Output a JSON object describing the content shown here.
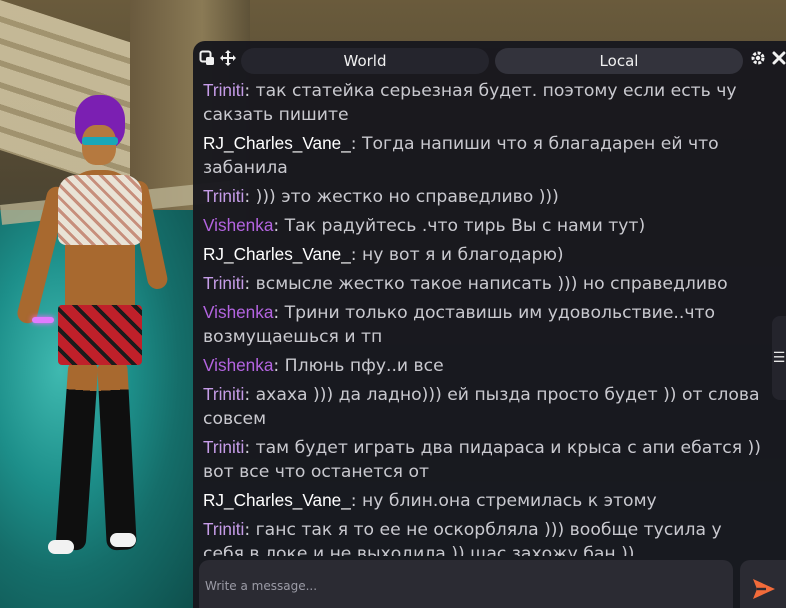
{
  "chat": {
    "tabs": [
      {
        "label": "World",
        "active": false
      },
      {
        "label": "Local",
        "active": true
      }
    ],
    "icons": {
      "popout": "popout-icon",
      "move": "move-icon",
      "settings": "gear-icon",
      "close": "close-icon",
      "menu": "menu-icon",
      "send": "send-icon"
    },
    "colors": {
      "triniti": "#c69ce8",
      "vishenka": "#b364e0",
      "rj": "#ffffff",
      "text": "#c9c9cf",
      "send": "#f26b3a"
    },
    "messages": [
      {
        "user": "Triniti",
        "text": "так статейка серьезная будет. поэтому если есть чу сакзать пишите"
      },
      {
        "user": "RJ_Charles_Vane_",
        "text": "Тогда напиши что я благадарен ей что забанила"
      },
      {
        "user": "Triniti",
        "text": "))) это жестко но справедливо )))"
      },
      {
        "user": "Vishenka",
        "text": "Так радуйтесь .что тирь Вы с нами тут)"
      },
      {
        "user": "RJ_Charles_Vane_",
        "text": "ну вот я и благодарю)"
      },
      {
        "user": "Triniti",
        "text": "всмысле жестко такое написать ))) но справедливо"
      },
      {
        "user": "Vishenka",
        "text": "Трини только доставишь им удовольствие..что возмущаешься и тп"
      },
      {
        "user": "Vishenka",
        "text": "Плюнь пфу..и все"
      },
      {
        "user": "Triniti",
        "text": "ахаха ))) да ладно))) ей пызда просто будет )) от слова совсем"
      },
      {
        "user": "Triniti",
        "text": "там будет играть два пидараса и крыса с апи ебатся )) вот все что останется от"
      },
      {
        "user": "RJ_Charles_Vane_",
        "text": "ну блин.она стремилась к этому"
      },
      {
        "user": "Triniti",
        "text": "ганс так я то ее не оскорбляла ))) вообще тусила у себя в локе и не выходила )) щас захожу бан ))"
      }
    ],
    "input": {
      "placeholder": "Write a message..."
    }
  }
}
